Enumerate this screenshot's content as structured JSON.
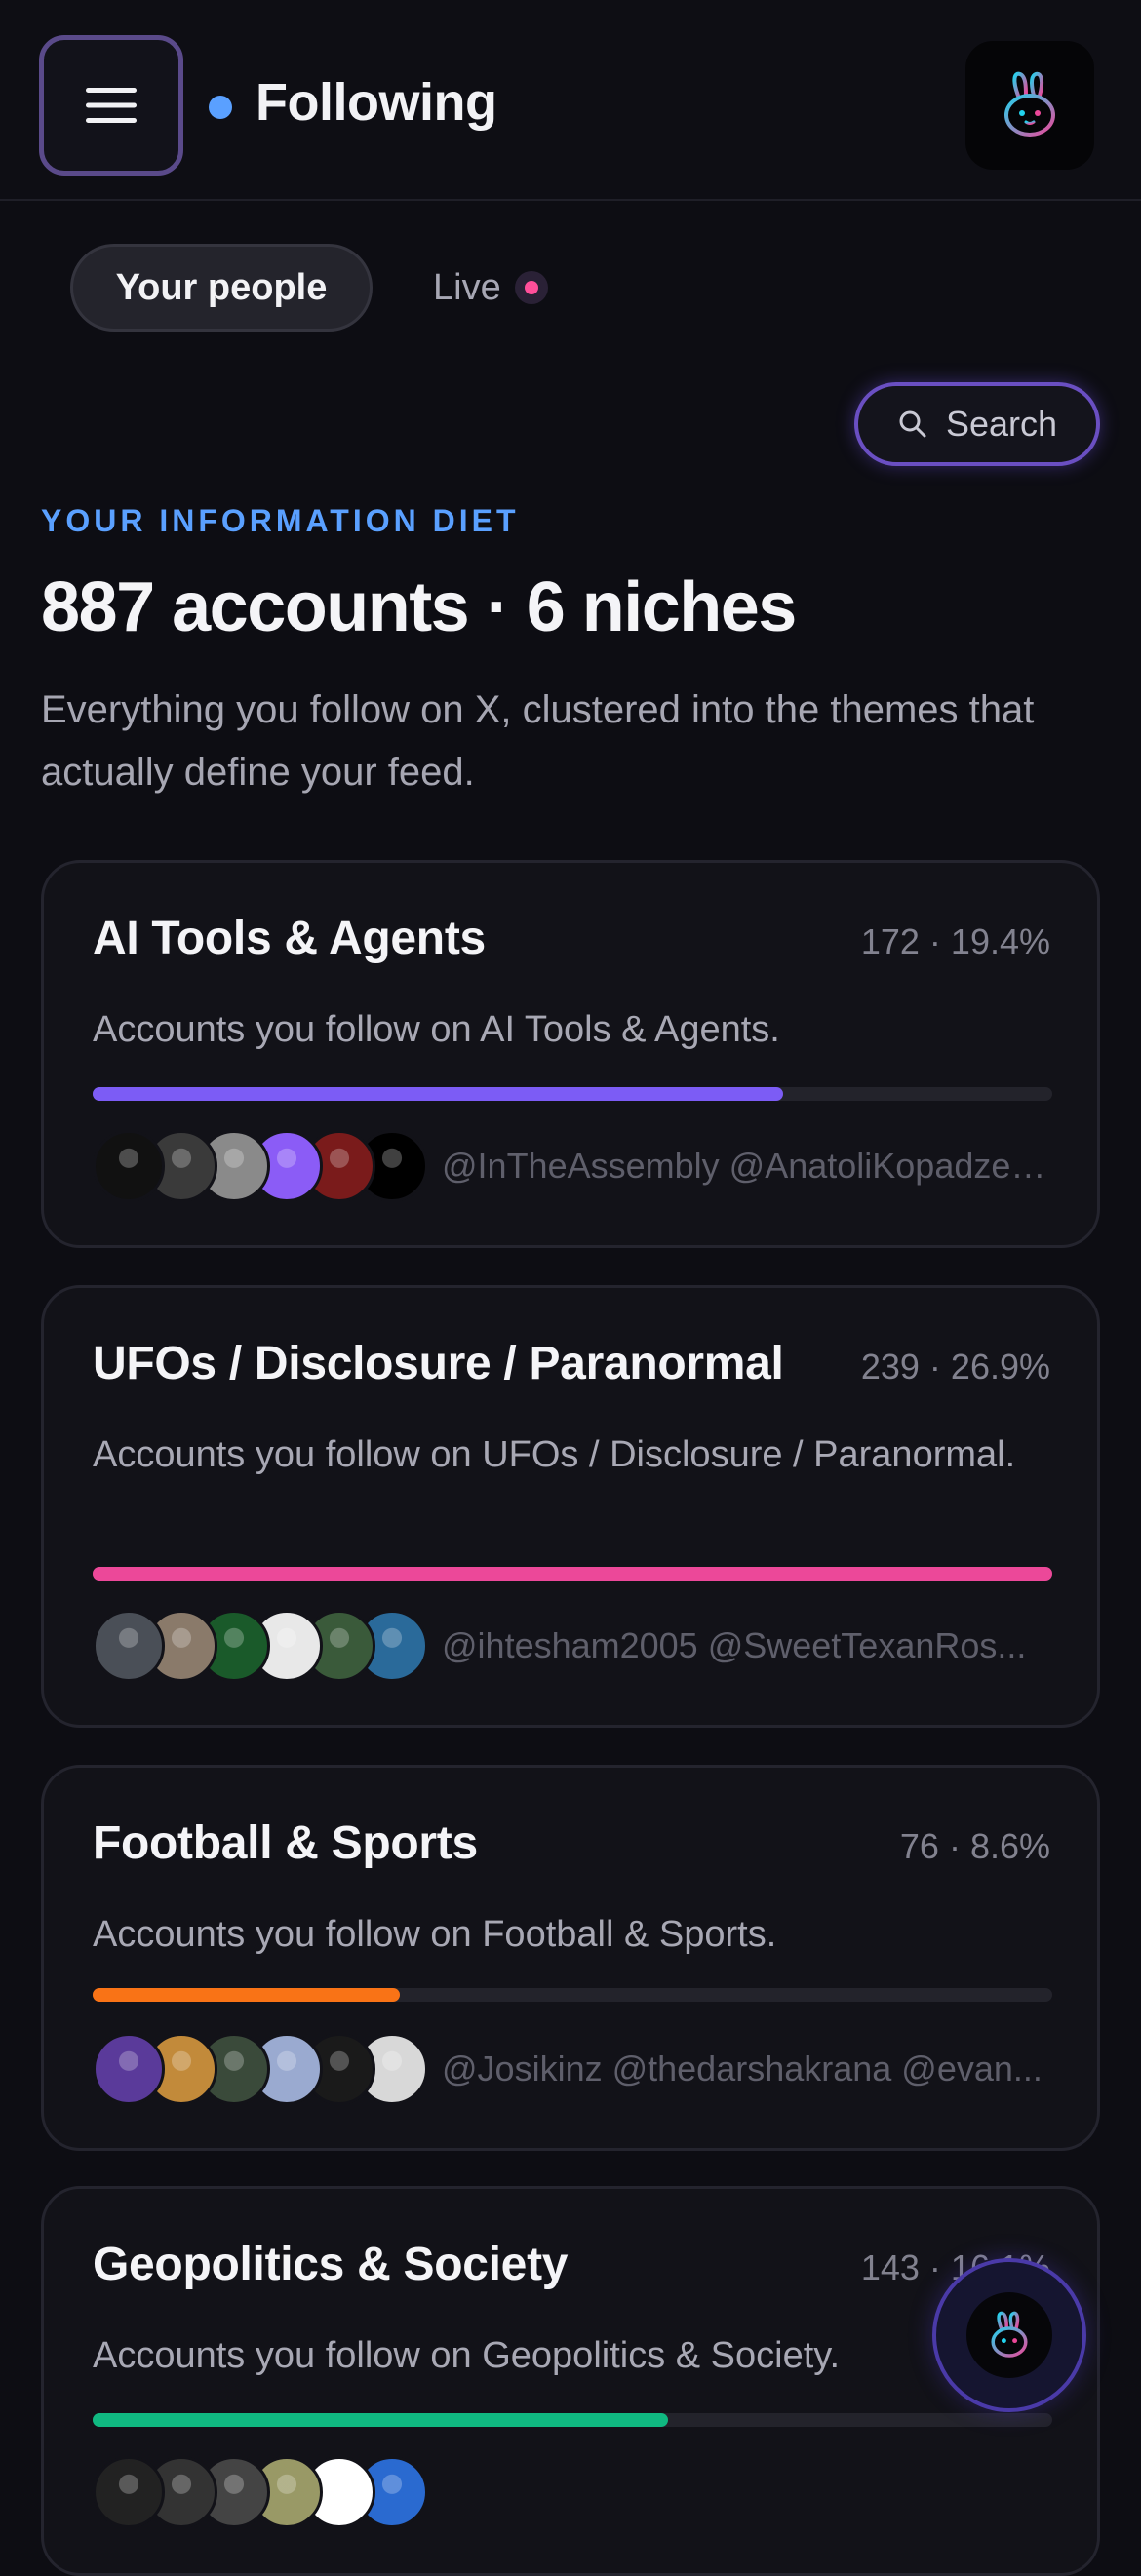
{
  "header": {
    "title": "Following",
    "menu_icon": "hamburger-menu-icon",
    "logo_icon": "bunny-logo-icon",
    "status_dot_color": "#5aa0ff"
  },
  "tabs": [
    {
      "label": "Your people",
      "active": true
    },
    {
      "label": "Live",
      "active": false,
      "indicator_color": "#ff4f9a"
    }
  ],
  "search": {
    "label": "Search",
    "icon": "search-icon"
  },
  "overview": {
    "eyebrow": "YOUR INFORMATION DIET",
    "headline": "887 accounts · 6 niches",
    "description": "Everything you follow on X, clustered into the themes that actually define your feed."
  },
  "niches": [
    {
      "title": "AI Tools & Agents",
      "stats": "172 · 19.4%",
      "description": "Accounts you follow on AI Tools & Agents.",
      "fraction": 0.72,
      "color": "#7c5cf5",
      "handles": "@InTheAssembly @AnatoliKopadze ...",
      "avatar_colors": [
        "#111111",
        "#3a3a3a",
        "#8a8a8a",
        "#8b5cf6",
        "#7a1b1b",
        "#000000"
      ]
    },
    {
      "title": "UFOs / Disclosure / Paranormal",
      "stats": "239 · 26.9%",
      "description": "Accounts you follow on UFOs / Disclosure / Paranormal.",
      "fraction": 1.0,
      "color": "#ec4899",
      "handles": "@ihtesham2005 @SweetTexanRos...",
      "avatar_colors": [
        "#4a4f57",
        "#8a7a6a",
        "#1a5a2a",
        "#e8e8e8",
        "#3a5a3a",
        "#2a6a9a"
      ]
    },
    {
      "title": "Football & Sports",
      "stats": "76 · 8.6%",
      "description": "Accounts you follow on Football & Sports.",
      "fraction": 0.32,
      "color": "#f97316",
      "handles": "@Josikinz @thedarshakrana @evan...",
      "avatar_colors": [
        "#5a3a9a",
        "#c28a3a",
        "#3a4a3a",
        "#9aaad0",
        "#1a1a1a",
        "#d8d8d8"
      ]
    },
    {
      "title": "Geopolitics & Society",
      "stats": "143 · 16.1%",
      "description": "Accounts you follow on Geopolitics & Society.",
      "fraction": 0.6,
      "color": "#10b981",
      "handles": "",
      "avatar_colors": [
        "#222222",
        "#333333",
        "#444444",
        "#999966",
        "#ffffff",
        "#2a6ad0"
      ]
    }
  ],
  "fab_icon": "bunny-logo-icon"
}
